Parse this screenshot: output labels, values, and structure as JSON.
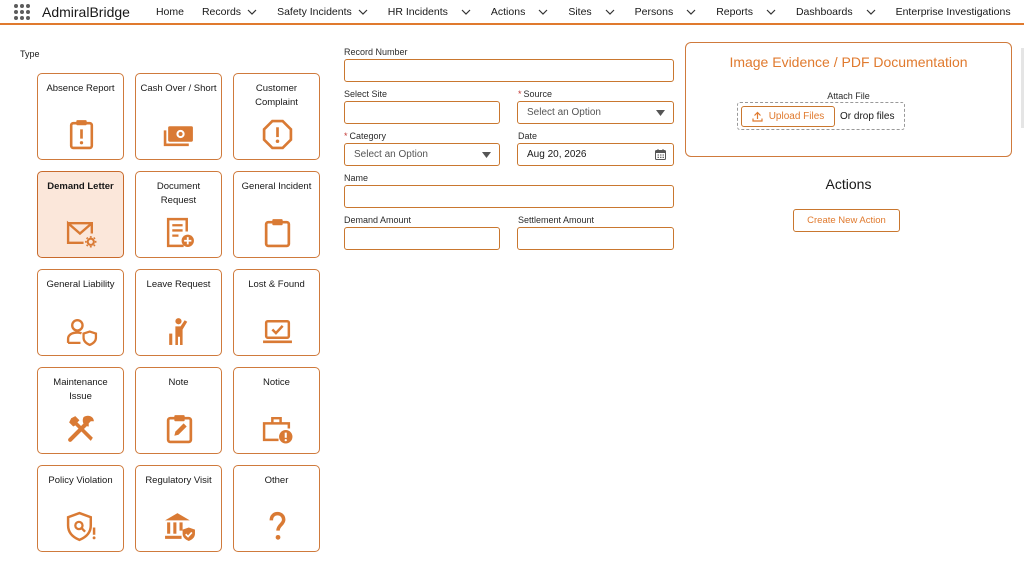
{
  "app": {
    "name": "AdmiralBridge"
  },
  "nav": [
    {
      "label": "Home",
      "dropdown": false
    },
    {
      "label": "Records",
      "dropdown": true
    },
    {
      "label": "Safety Incidents",
      "dropdown": true
    },
    {
      "label": "HR Incidents",
      "dropdown": true
    },
    {
      "label": "Actions",
      "dropdown": true
    },
    {
      "label": "Sites",
      "dropdown": true
    },
    {
      "label": "Persons",
      "dropdown": true
    },
    {
      "label": "Reports",
      "dropdown": true
    },
    {
      "label": "Dashboards",
      "dropdown": true
    },
    {
      "label": "Enterprise Investigations",
      "dropdown": true
    }
  ],
  "type_section": {
    "label": "Type",
    "selected": "Demand Letter",
    "tiles": [
      {
        "label": "Absence Report",
        "icon": "alert-clipboard-icon"
      },
      {
        "label": "Cash Over / Short",
        "icon": "money-icon"
      },
      {
        "label": "Customer Complaint",
        "icon": "octagon-warning-icon"
      },
      {
        "label": "Demand Letter",
        "icon": "email-gear-icon"
      },
      {
        "label": "Document Request",
        "icon": "document-add-icon"
      },
      {
        "label": "General Incident",
        "icon": "clipboard-icon"
      },
      {
        "label": "General Liability",
        "icon": "user-shield-icon"
      },
      {
        "label": "Leave Request",
        "icon": "person-leaving-icon"
      },
      {
        "label": "Lost & Found",
        "icon": "laptop-check-icon"
      },
      {
        "label": "Maintenance Issue",
        "icon": "tools-icon"
      },
      {
        "label": "Note",
        "icon": "clipboard-edit-icon"
      },
      {
        "label": "Notice",
        "icon": "briefcase-alert-icon"
      },
      {
        "label": "Policy Violation",
        "icon": "shield-search-icon"
      },
      {
        "label": "Regulatory Visit",
        "icon": "bank-shield-icon"
      },
      {
        "label": "Other",
        "icon": "question-icon"
      }
    ]
  },
  "form": {
    "record_number": {
      "label": "Record Number",
      "value": ""
    },
    "select_site": {
      "label": "Select Site",
      "value": ""
    },
    "source": {
      "label": "Source",
      "required": "*",
      "placeholder": "Select an Option"
    },
    "category": {
      "label": "Category",
      "required": "*",
      "placeholder": "Select an Option"
    },
    "date": {
      "label": "Date",
      "value": "Aug 20, 2026"
    },
    "name": {
      "label": "Name",
      "value": ""
    },
    "demand_amount": {
      "label": "Demand Amount",
      "value": ""
    },
    "settlement_amount": {
      "label": "Settlement Amount",
      "value": ""
    }
  },
  "evidence": {
    "title": "Image Evidence / PDF Documentation",
    "attach_label": "Attach File",
    "upload_button": "Upload Files",
    "drop_text": "Or drop files"
  },
  "actions": {
    "title": "Actions",
    "create_button": "Create New Action"
  },
  "colors": {
    "accent": "#e07a2e",
    "border": "#cf7a3c",
    "selected_bg": "#fbe7da"
  }
}
